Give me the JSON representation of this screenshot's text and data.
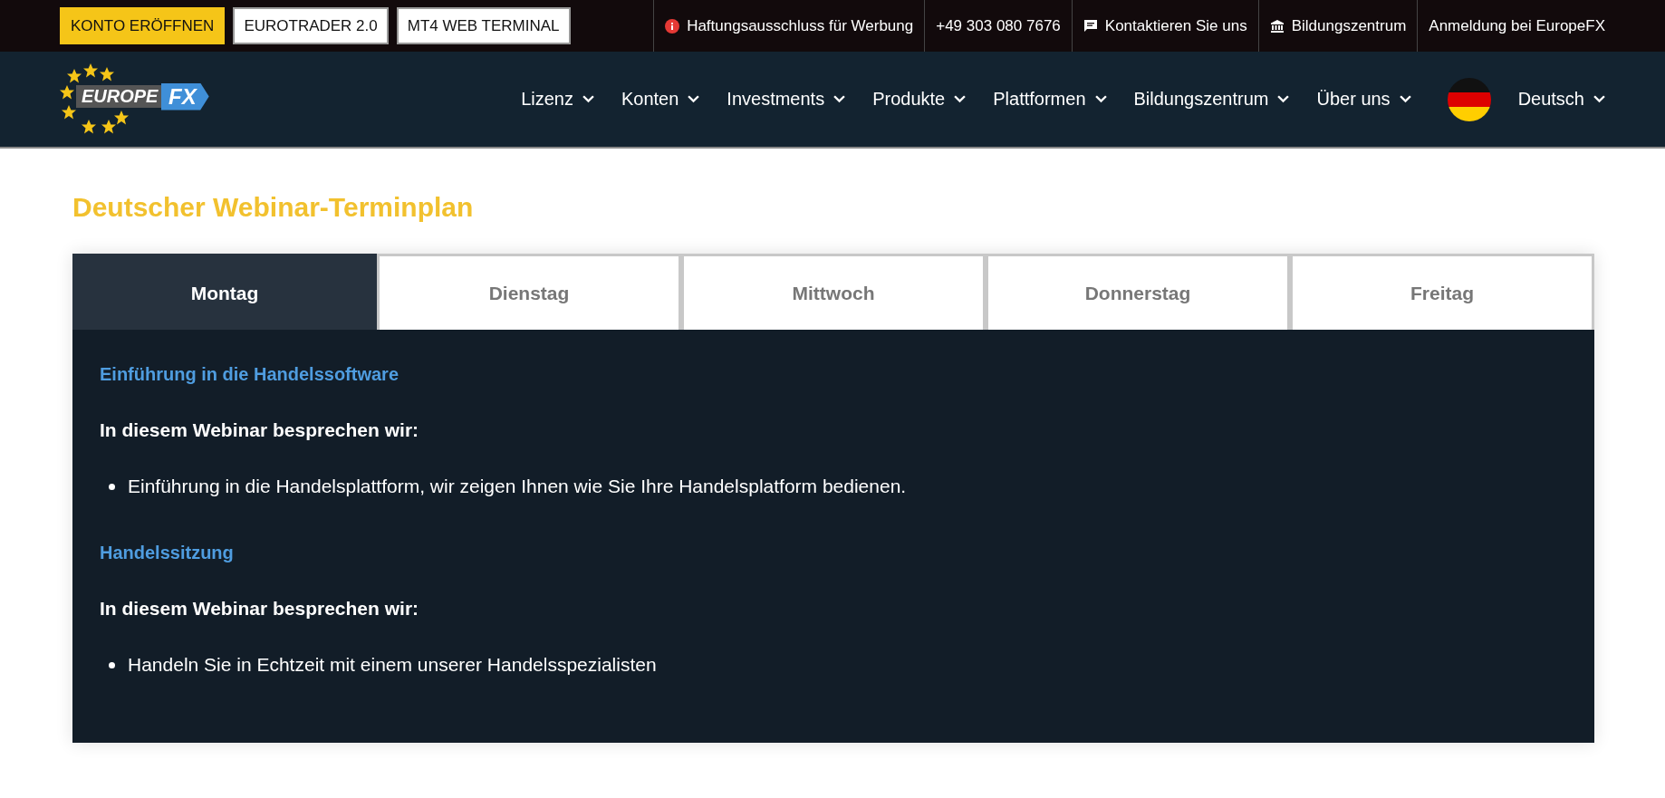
{
  "top_bar": {
    "buttons": [
      {
        "label": "KONTO ERÖFFNEN",
        "kind": "primary"
      },
      {
        "label": "EUROTRADER 2.0",
        "kind": "outline"
      },
      {
        "label": "MT4 WEB TERMINAL",
        "kind": "outline"
      }
    ],
    "links": [
      {
        "label": "Haftungsausschluss für Werbung",
        "kind": "notice"
      },
      {
        "label": "+49 303 080 7676",
        "kind": "plain"
      },
      {
        "label": "Kontaktieren Sie uns",
        "kind": "contact"
      },
      {
        "label": "Bildungszentrum",
        "kind": "education"
      },
      {
        "label": "Anmeldung bei EuropeFX",
        "kind": "plain"
      }
    ]
  },
  "logo": {
    "word": "EUROPE",
    "badge": "FX"
  },
  "nav": {
    "items": [
      "Lizenz",
      "Konten",
      "Investments",
      "Produkte",
      "Plattformen",
      "Bildungszentrum",
      "Über uns"
    ],
    "language": "Deutsch"
  },
  "page_title": "Deutscher Webinar-Terminplan",
  "tabs": [
    {
      "label": "Montag",
      "selected": true
    },
    {
      "label": "Dienstag",
      "selected": false
    },
    {
      "label": "Mittwoch",
      "selected": false
    },
    {
      "label": "Donnerstag",
      "selected": false
    },
    {
      "label": "Freitag",
      "selected": false
    }
  ],
  "sessions": [
    {
      "title": "Einführung in die Handelssoftware",
      "intro": "In diesem Webinar besprechen wir:",
      "points": [
        "Einführung in die Handelsplattform, wir zeigen Ihnen wie Sie Ihre Handelsplatform bedienen."
      ]
    },
    {
      "title": "Handelssitzung",
      "intro": "In diesem Webinar besprechen wir:",
      "points": [
        "Handeln Sie in Echtzeit mit einem unserer Handelsspezialisten"
      ]
    }
  ]
}
